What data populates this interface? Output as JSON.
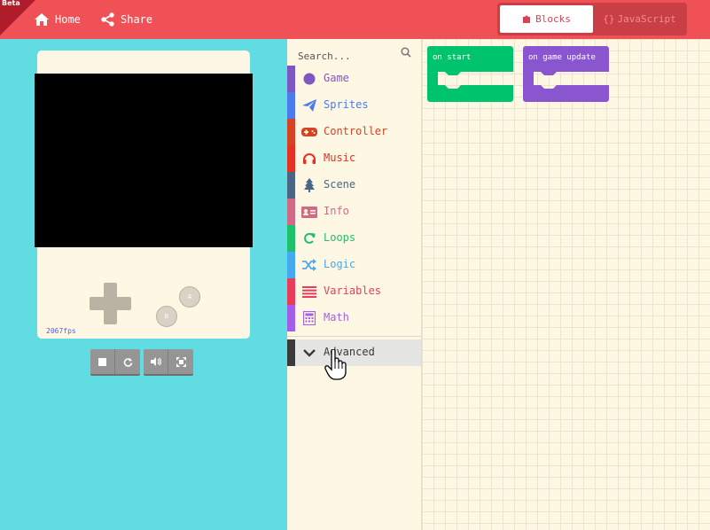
{
  "header": {
    "beta_label": "Beta",
    "home_label": "Home",
    "share_label": "Share",
    "blocks_label": "Blocks",
    "javascript_label": "JavaScript"
  },
  "simulator": {
    "fps_label": "2067fps",
    "button_a": "A",
    "button_b": "B"
  },
  "toolbox": {
    "search_placeholder": "Search...",
    "categories": [
      {
        "label": "Game",
        "color": "#7E57C2",
        "icon": "circle-icon"
      },
      {
        "label": "Sprites",
        "color": "#4B7BEC",
        "icon": "paper-plane-icon"
      },
      {
        "label": "Controller",
        "color": "#D54322",
        "icon": "gamepad-icon"
      },
      {
        "label": "Music",
        "color": "#E63022",
        "icon": "headphones-icon"
      },
      {
        "label": "Scene",
        "color": "#4B6584",
        "icon": "tree-icon"
      },
      {
        "label": "Info",
        "color": "#CF6A87",
        "icon": "id-card-icon"
      },
      {
        "label": "Loops",
        "color": "#20BF6B",
        "icon": "refresh-icon"
      },
      {
        "label": "Logic",
        "color": "#45AAF2",
        "icon": "shuffle-icon"
      },
      {
        "label": "Variables",
        "color": "#EB3B5A",
        "icon": "list-icon"
      },
      {
        "label": "Math",
        "color": "#A55EEA",
        "icon": "calculator-icon"
      }
    ],
    "advanced_label": "Advanced"
  },
  "workspace": {
    "on_start_label": "on start",
    "on_game_update_label": "on game update",
    "on_start_color": "#00C36E",
    "on_game_update_color": "#8A56CF"
  },
  "colors": {
    "header": "#EF5156",
    "background": "#62DCE3"
  }
}
